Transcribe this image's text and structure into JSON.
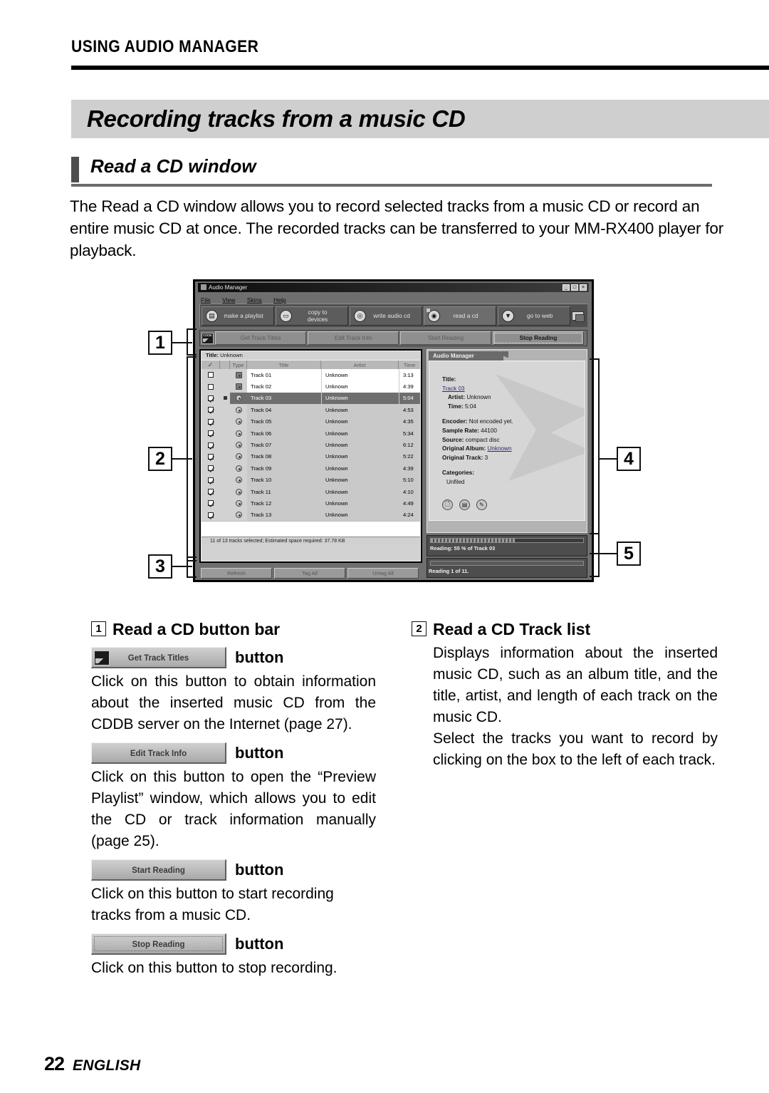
{
  "page": {
    "kicker": "USING AUDIO MANAGER",
    "title": "Recording tracks from a music CD",
    "subtitle": "Read a CD window",
    "intro": "The Read a CD window allows you to record selected tracks from a music CD or record an entire music CD at once. The recorded tracks can be transferred to your MM-RX400 player for playback.",
    "page_number": "22",
    "language": "ENGLISH"
  },
  "callouts": {
    "one": "1",
    "two": "2",
    "three": "3",
    "four": "4",
    "five": "5"
  },
  "app": {
    "window_title": "Audio Manager",
    "window_icon": "audio-manager-icon",
    "window_buttons": {
      "minimize": "_",
      "maximize": "□",
      "close": "×"
    },
    "menus": [
      "File",
      "View",
      "Skins",
      "Help"
    ],
    "toolbar": [
      {
        "label": "make a playlist",
        "icon": "playlist-icon",
        "glyph": "▤",
        "selected": false
      },
      {
        "label": "copy to devices",
        "icon": "device-icon",
        "glyph": "▭",
        "selected": false
      },
      {
        "label": "write audio cd",
        "icon": "burn-cd-icon",
        "glyph": "◎",
        "selected": false
      },
      {
        "label": "read a cd",
        "icon": "read-cd-icon",
        "glyph": "◉",
        "selected": true
      },
      {
        "label": "go to web",
        "icon": "web-icon",
        "glyph": "▼",
        "selected": false
      }
    ],
    "button_bar": [
      {
        "label": "Get Track Titles",
        "active": false
      },
      {
        "label": "Edit Track Info",
        "active": false
      },
      {
        "label": "Start Reading",
        "active": false
      },
      {
        "label": "Stop Reading",
        "active": true
      }
    ],
    "track_list": {
      "album_label": "Title:",
      "album_value": "Unknown",
      "columns": [
        "✓",
        "",
        "Type",
        "Title",
        "Artist",
        "Time"
      ],
      "rows": [
        {
          "checked": false,
          "mark": false,
          "type": "music-note-icon",
          "title": "Track 01",
          "artist": "Unknown",
          "time": "3:13",
          "selected": false
        },
        {
          "checked": false,
          "mark": false,
          "type": "music-note-icon",
          "title": "Track 02",
          "artist": "Unknown",
          "time": "4:39",
          "selected": false
        },
        {
          "checked": true,
          "mark": true,
          "type": "cd-icon",
          "title": "Track 03",
          "artist": "Unknown",
          "time": "5:04",
          "selected": true
        },
        {
          "checked": true,
          "mark": false,
          "type": "cd-icon",
          "title": "Track 04",
          "artist": "Unknown",
          "time": "4:53",
          "selected": false
        },
        {
          "checked": true,
          "mark": false,
          "type": "cd-icon",
          "title": "Track 05",
          "artist": "Unknown",
          "time": "4:35",
          "selected": false
        },
        {
          "checked": true,
          "mark": false,
          "type": "cd-icon",
          "title": "Track 06",
          "artist": "Unknown",
          "time": "5:34",
          "selected": false
        },
        {
          "checked": true,
          "mark": false,
          "type": "cd-icon",
          "title": "Track 07",
          "artist": "Unknown",
          "time": "6:12",
          "selected": false
        },
        {
          "checked": true,
          "mark": false,
          "type": "cd-icon",
          "title": "Track 08",
          "artist": "Unknown",
          "time": "5:22",
          "selected": false
        },
        {
          "checked": true,
          "mark": false,
          "type": "cd-icon",
          "title": "Track 09",
          "artist": "Unknown",
          "time": "4:39",
          "selected": false
        },
        {
          "checked": true,
          "mark": false,
          "type": "cd-icon",
          "title": "Track 10",
          "artist": "Unknown",
          "time": "5:10",
          "selected": false
        },
        {
          "checked": true,
          "mark": false,
          "type": "cd-icon",
          "title": "Track 11",
          "artist": "Unknown",
          "time": "4:10",
          "selected": false
        },
        {
          "checked": true,
          "mark": false,
          "type": "cd-icon",
          "title": "Track 12",
          "artist": "Unknown",
          "time": "4:49",
          "selected": false
        },
        {
          "checked": true,
          "mark": false,
          "type": "cd-icon",
          "title": "Track 13",
          "artist": "Unknown",
          "time": "4:24",
          "selected": false
        }
      ],
      "status": "11 of 13 tracks selected;  Estimated space required: 37.78 KB",
      "buttons": [
        "Refresh",
        "Tag All",
        "Untag All"
      ]
    },
    "info_panel": {
      "tab_label": "Audio Manager",
      "title_label": "Title:",
      "title_value": "Track 03",
      "artist_label": "Artist:",
      "artist_value": "Unknown",
      "time_label": "Time:",
      "time_value": "5:04",
      "encoder_label": "Encoder:",
      "encoder_value": "Not encoded yet.",
      "sample_rate_label": "Sample Rate:",
      "sample_rate_value": "44100",
      "source_label": "Source:",
      "source_value": "compact disc",
      "original_album_label": "Original Album:",
      "original_album_value": "Unknown",
      "original_track_label": "Original Track:",
      "original_track_value": "3",
      "categories_label": "Categories:",
      "categories_value": "Unfiled",
      "buttons": [
        {
          "icon": "file-icon",
          "glyph": "🗋"
        },
        {
          "icon": "save-icon",
          "glyph": "▤"
        },
        {
          "icon": "edit-icon",
          "glyph": "✎"
        }
      ]
    },
    "progress": {
      "track_percent": 55,
      "track_text": "Reading:  55 % of Track 03",
      "overall_text": "Reading 1 of 11.",
      "overall_percent": 0
    }
  },
  "sections": {
    "left": {
      "number": "1",
      "heading": "Read a CD button bar",
      "items": [
        {
          "button_label": "Get Track Titles",
          "button_icon": "cddb-icon",
          "dotted": false,
          "word": "button",
          "body": "Click on this button to obtain information about the inserted music CD from the CDDB server on the Internet (page 27)."
        },
        {
          "button_label": "Edit Track Info",
          "button_icon": "",
          "dotted": false,
          "word": "button",
          "body": "Click on this button to open the “Preview Playlist” window, which allows you to edit the CD or track information manually (page 25)."
        },
        {
          "button_label": "Start Reading",
          "button_icon": "",
          "dotted": false,
          "word": "button",
          "body": "Click on this button to start recording tracks from a music CD."
        },
        {
          "button_label": "Stop Reading",
          "button_icon": "",
          "dotted": true,
          "word": "button",
          "body": "Click on this button to stop recording."
        }
      ]
    },
    "right": {
      "number": "2",
      "heading": "Read a CD Track list",
      "paragraphs": [
        "Displays information about the inserted music CD, such as an album title, and the title, artist, and length of each track on the music CD.",
        "Select the tracks you want to record by clicking on the box to the left of each track."
      ]
    }
  }
}
